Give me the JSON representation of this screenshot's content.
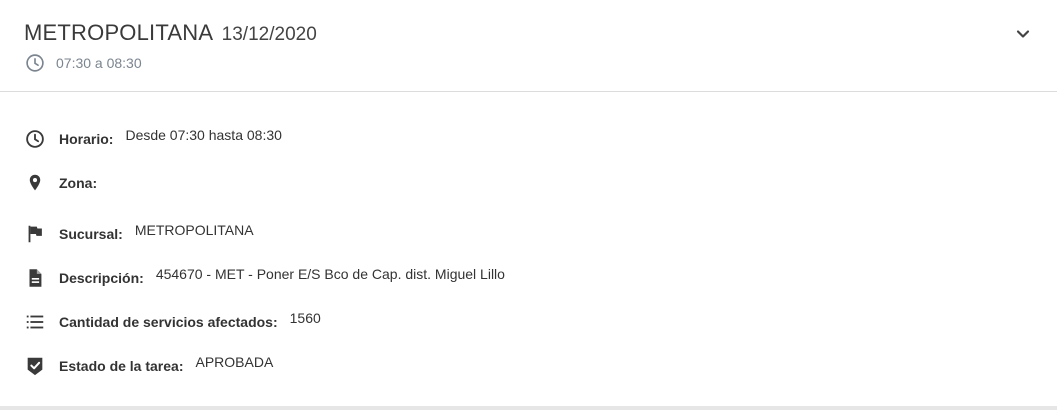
{
  "header": {
    "title": "METROPOLITANA",
    "date": "13/12/2020",
    "time_range": "07:30 a 08:30"
  },
  "details": {
    "horario_label": "Horario:",
    "horario_value": "Desde 07:30 hasta 08:30",
    "zona_label": "Zona:",
    "zona_value": "",
    "sucursal_label": "Sucursal:",
    "sucursal_value": "METROPOLITANA",
    "descripcion_label": "Descripción:",
    "descripcion_value": "454670 - MET - Poner E/S Bco de Cap. dist. Miguel Lillo",
    "cantidad_label": "Cantidad de servicios afectados:",
    "cantidad_value": "1560",
    "estado_label": "Estado de la tarea:",
    "estado_value": "APROBADA"
  },
  "icons": {
    "header_clock": "clock-icon",
    "expand": "chevron-down-icon",
    "horario": "clock-icon",
    "zona": "map-pin-icon",
    "sucursal": "flag-icon",
    "descripcion": "document-icon",
    "cantidad": "list-icon",
    "estado": "check-shield-icon"
  },
  "colors": {
    "header_time": "#7b8590",
    "icon": "#3a3a3a",
    "divider": "#dcdcdc"
  }
}
